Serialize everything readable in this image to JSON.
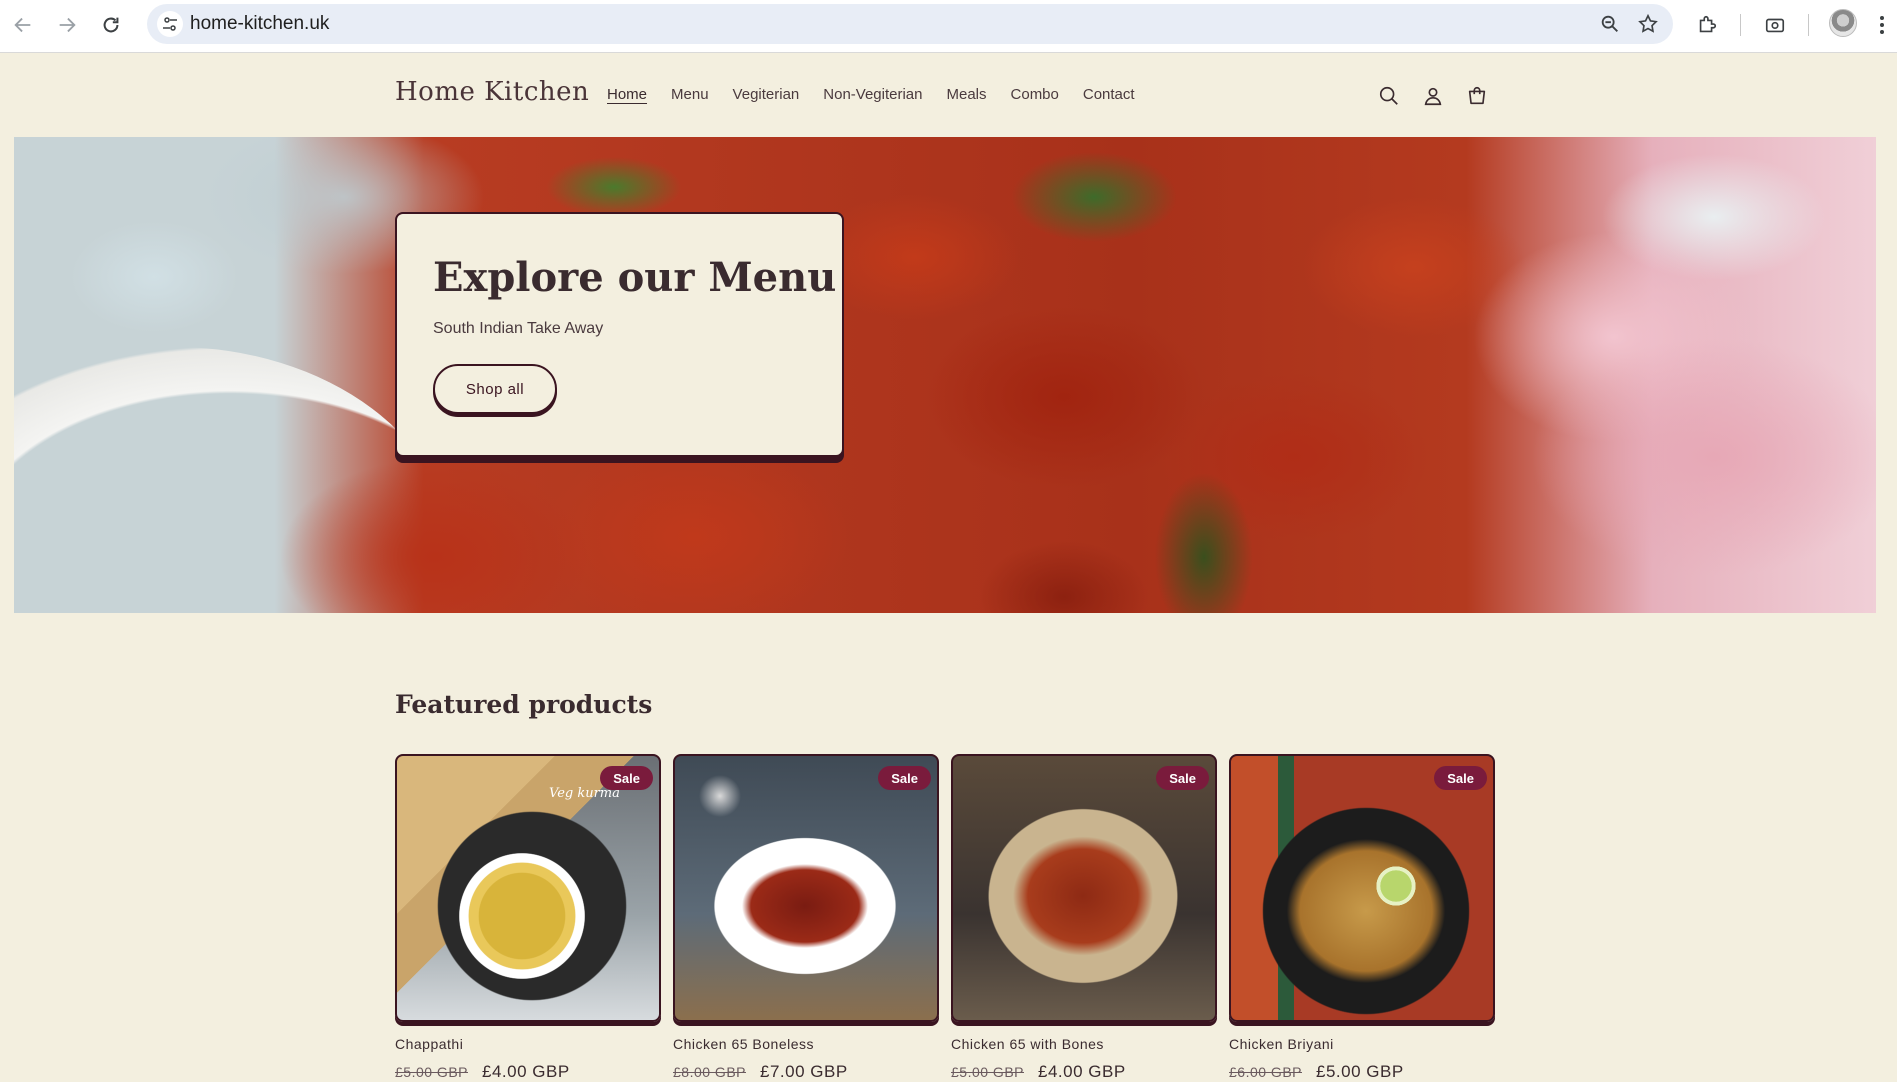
{
  "browser": {
    "url": "home-kitchen.uk"
  },
  "site": {
    "logo": "Home Kitchen",
    "nav": [
      {
        "label": "Home",
        "active": true
      },
      {
        "label": "Menu",
        "active": false
      },
      {
        "label": "Vegiterian",
        "active": false
      },
      {
        "label": "Non-Vegiterian",
        "active": false
      },
      {
        "label": "Meals",
        "active": false
      },
      {
        "label": "Combo",
        "active": false
      },
      {
        "label": "Contact",
        "active": false
      }
    ],
    "header_icons": [
      "search-icon",
      "account-icon",
      "cart-icon"
    ]
  },
  "hero": {
    "title": "Explore our Menu",
    "subtitle": "South Indian Take Away",
    "button_label": "Shop all"
  },
  "featured": {
    "title": "Featured products",
    "products": [
      {
        "name": "Chappathi",
        "old_price": "£5.00 GBP",
        "price": "£4.00 GBP",
        "badge": "Sale",
        "image_caption": "Veg kurma"
      },
      {
        "name": "Chicken 65 Boneless",
        "old_price": "£8.00 GBP",
        "price": "£7.00 GBP",
        "badge": "Sale"
      },
      {
        "name": "Chicken 65 with Bones",
        "old_price": "£5.00 GBP",
        "price": "£4.00 GBP",
        "badge": "Sale"
      },
      {
        "name": "Chicken Briyani",
        "old_price": "£6.00 GBP",
        "price": "£5.00 GBP",
        "badge": "Sale"
      }
    ]
  },
  "colors": {
    "background": "#f3efdf",
    "accent": "#3a1420",
    "sale_badge": "#7a1b3c"
  }
}
